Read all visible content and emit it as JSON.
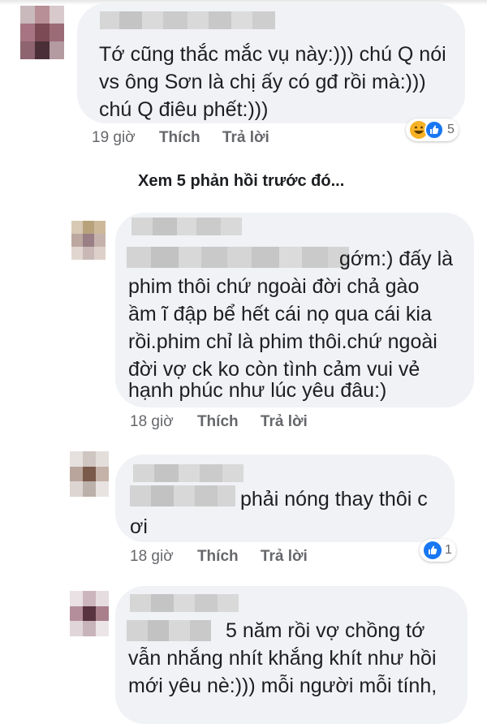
{
  "comments": [
    {
      "text_lines": [
        "Tớ cũng thắc mắc vụ này:))) chú Q nói",
        "vs ông Sơn là chị ấy có gđ rồi mà:)))",
        "chú Q điêu phết:)))"
      ],
      "time": "19 giờ",
      "like_label": "Thích",
      "reply_label": "Trả lời",
      "reaction_icons": [
        "haha-reaction-icon",
        "like-reaction-icon"
      ],
      "reaction_count": "5"
    }
  ],
  "view_previous_replies": "Xem 5 phản hồi trước đó...",
  "replies": [
    {
      "text_lines": [
        "gớm:) đấy là",
        "phim thôi chứ ngoài đời chả gào",
        "ầm ĩ đập bể hết cái nọ qua cái kia",
        "rồi.phim chỉ là phim thôi.chứ ngoài",
        "đời vợ ck ko còn tình cảm vui vẻ",
        "hạnh phúc như lúc yêu đâu:)"
      ],
      "time": "18 giờ",
      "like_label": "Thích",
      "reply_label": "Trả lời"
    },
    {
      "text_lines": [
        "phải nóng thay thôi c",
        "ơi"
      ],
      "time": "18 giờ",
      "like_label": "Thích",
      "reply_label": "Trả lời",
      "reaction_icons": [
        "like-reaction-icon"
      ],
      "reaction_count": "1"
    },
    {
      "text_lines": [
        "5 năm rồi vợ chồng tớ",
        "vẫn nhắng nhít khắng khít như hồi",
        "mới yêu nè:))) mỗi người mỗi tính,"
      ]
    }
  ],
  "colors": {
    "bubble": "#f0f2f5",
    "meta_text": "#65676b",
    "like_blue": "#1877f2",
    "haha_yellow": "#f7b125"
  }
}
